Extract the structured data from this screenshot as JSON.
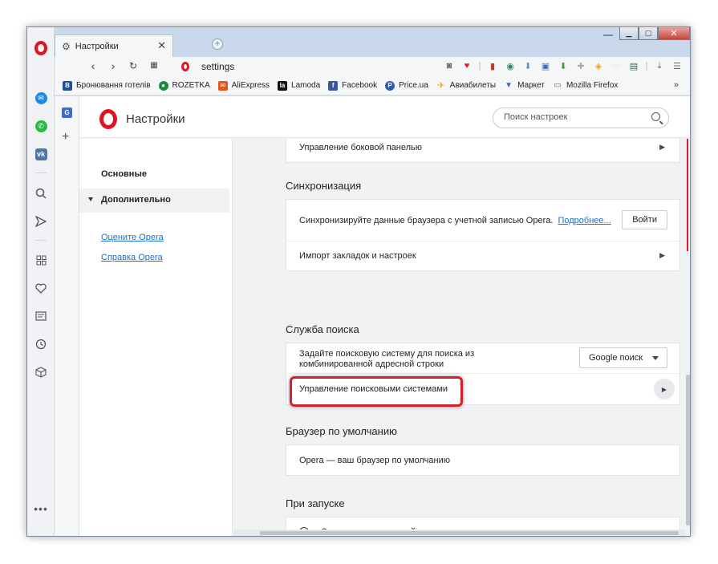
{
  "tab": {
    "title": "Настройки"
  },
  "address": {
    "url": "settings"
  },
  "bookmarks": [
    {
      "label": "Бронювання готелів",
      "icon": "booking-icon",
      "color": "#1f4f9a",
      "glyph": "B"
    },
    {
      "label": "ROZETKA",
      "icon": "rozetka-icon",
      "color": "#1e8b3a",
      "glyph": "●"
    },
    {
      "label": "AliExpress",
      "icon": "aliexpress-icon",
      "color": "#e8541d",
      "glyph": "✉"
    },
    {
      "label": "Lamoda",
      "icon": "lamoda-icon",
      "color": "#111111",
      "glyph": "la"
    },
    {
      "label": "Facebook",
      "icon": "facebook-icon",
      "color": "#3b5998",
      "glyph": "f"
    },
    {
      "label": "Price.ua",
      "icon": "priceua-icon",
      "color": "#2a5fb0",
      "glyph": "P"
    },
    {
      "label": "Авиабилеты",
      "icon": "airplane-icon",
      "color": "#e8a21d",
      "glyph": "✈"
    },
    {
      "label": "Маркет",
      "icon": "market-icon",
      "color": "#3a6fc8",
      "glyph": "🛒"
    },
    {
      "label": "Mozilla Firefox",
      "icon": "folder-icon",
      "color": "#777777",
      "glyph": "▢"
    }
  ],
  "header": {
    "title": "Настройки",
    "search_placeholder": "Поиск настроек"
  },
  "nav": {
    "basic": "Основные",
    "advanced": "Дополнительно",
    "rate": "Оцените Opera",
    "help": "Справка Opera"
  },
  "sections": {
    "sidebar_row": "Управление боковой панелью",
    "sync": {
      "title": "Синхронизация",
      "text": "Синхронизируйте данные браузера с учетной записью Opera.",
      "link": "Подробнее...",
      "button": "Войти",
      "import": "Импорт закладок и настроек"
    },
    "search": {
      "title": "Служба поиска",
      "text": "Задайте поисковую систему для поиска из комбинированной адресной строки",
      "select_value": "Google поиск",
      "manage": "Управление поисковыми системами"
    },
    "default_browser": {
      "title": "Браузер по умолчанию",
      "text": "Opera — ваш браузер по умолчанию"
    },
    "startup": {
      "title": "При запуске",
      "option1": "Запускать с начальной страницы"
    }
  },
  "colors": {
    "opera_red": "#e0141e",
    "link_blue": "#1a6fd1",
    "highlight_red": "#d4202a"
  }
}
